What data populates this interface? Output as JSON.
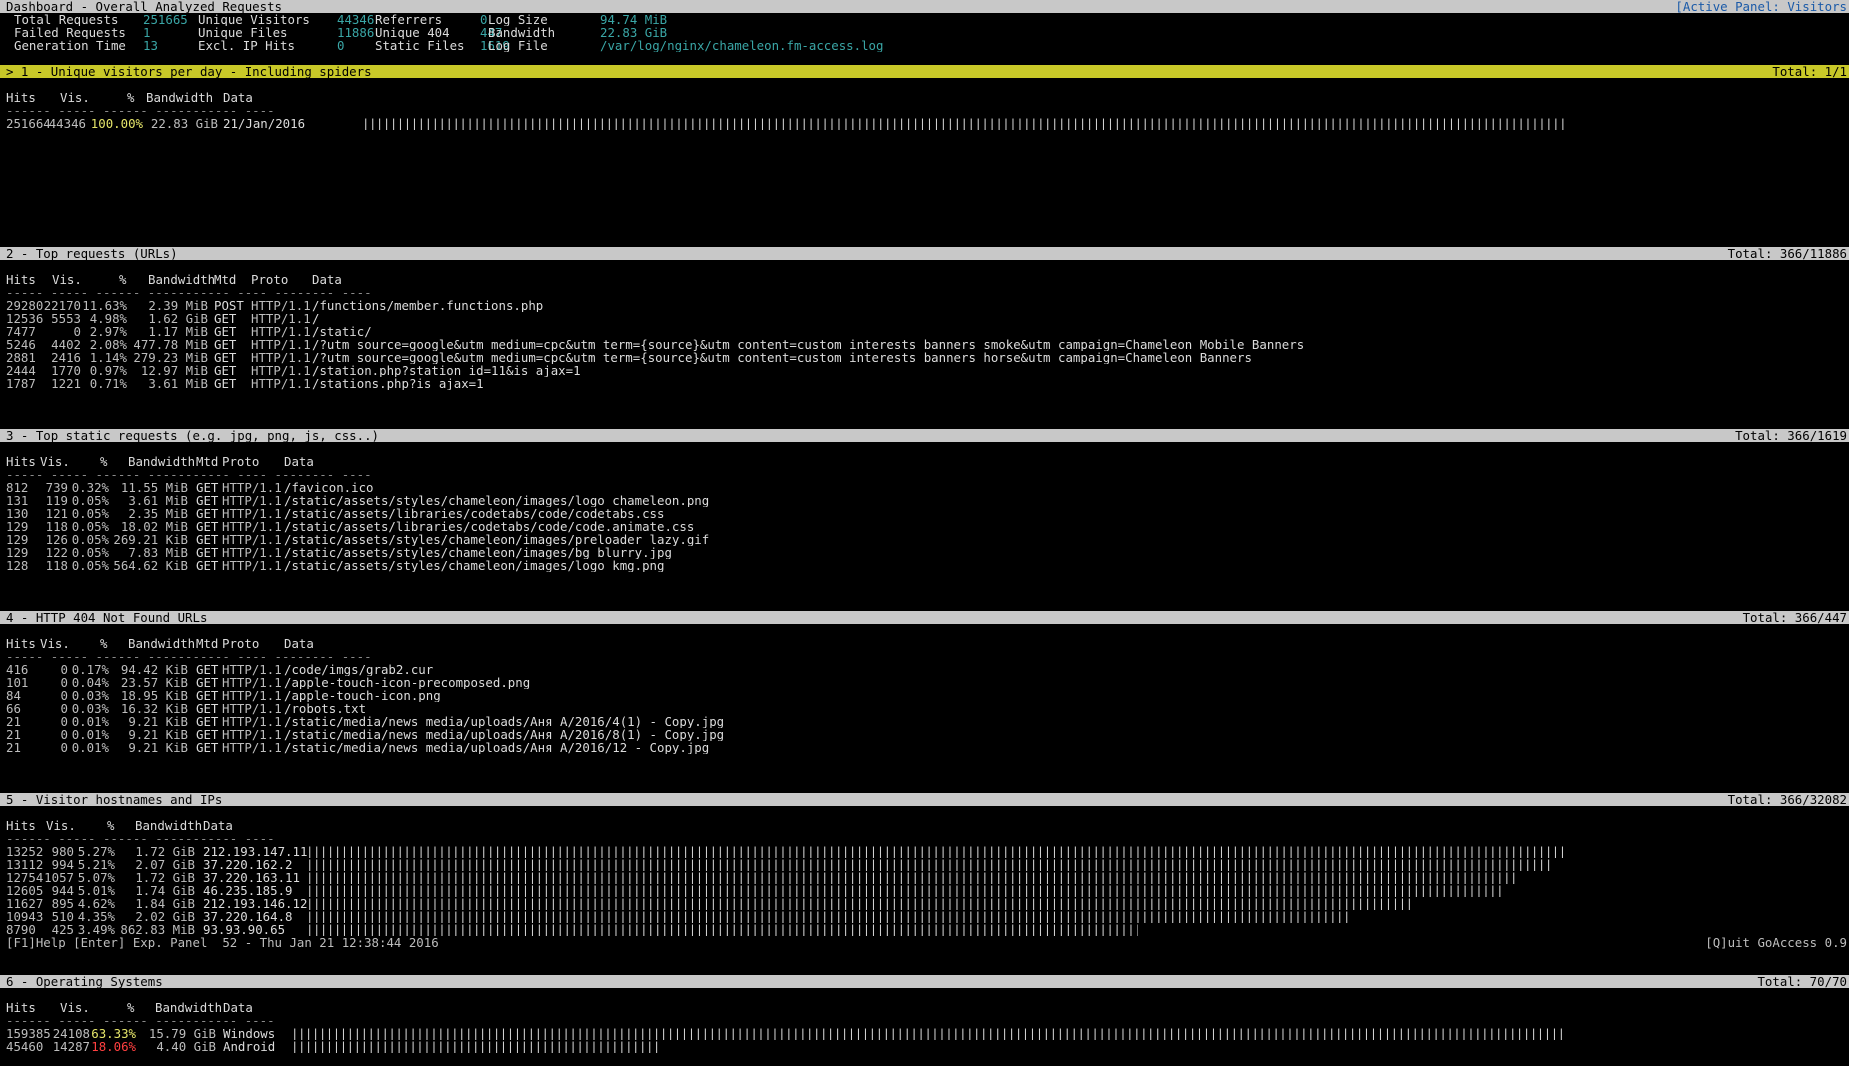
{
  "header": {
    "title": "Dashboard - Overall Analyzed Requests",
    "active_panel": "[Active Panel: Visitors"
  },
  "overall": {
    "rows": [
      [
        {
          "label": "Total Requests",
          "value": "251665"
        },
        {
          "label": "Unique Visitors",
          "value": "44346"
        },
        {
          "label": "Referrers",
          "value": "0"
        },
        {
          "label": "Log Size",
          "value": "94.74 MiB"
        }
      ],
      [
        {
          "label": "Failed Requests",
          "value": "1"
        },
        {
          "label": "Unique Files",
          "value": "11886"
        },
        {
          "label": "Unique 404",
          "value": "447"
        },
        {
          "label": "Bandwidth",
          "value": "22.83 GiB"
        }
      ],
      [
        {
          "label": "Generation Time",
          "value": "13"
        },
        {
          "label": "Excl. IP Hits",
          "value": "0"
        },
        {
          "label": "Static Files",
          "value": "1619"
        },
        {
          "label": "Log File",
          "value": "/var/log/nginx/chameleon.fm-access.log"
        }
      ]
    ]
  },
  "panels": [
    {
      "title": "> 1 - Unique visitors per day - Including spiders",
      "total": "Total: 1/1",
      "headers": [
        "Hits",
        "Vis.",
        "%",
        "Bandwidth",
        "Data"
      ],
      "rows": [
        {
          "hits": "251664",
          "vis": "44346",
          "pct": "100.00%",
          "bw": "22.83 GiB",
          "data": "21/Jan/2016",
          "bar": 1.0
        }
      ]
    },
    {
      "title": "2 - Top requests (URLs)",
      "total": "Total: 366/11886",
      "headers": [
        "Hits",
        "Vis.",
        "%",
        "Bandwidth",
        "Mtd",
        "Proto",
        "Data"
      ],
      "rows": [
        {
          "hits": "29280",
          "vis": "22170",
          "pct": "11.63%",
          "bw": "2.39 MiB",
          "mtd": "POST",
          "proto": "HTTP/1.1",
          "data": "/functions/member.functions.php"
        },
        {
          "hits": "12536",
          "vis": "5553",
          "pct": "4.98%",
          "bw": "1.62 GiB",
          "mtd": "GET",
          "proto": "HTTP/1.1",
          "data": "/"
        },
        {
          "hits": "7477",
          "vis": "0",
          "pct": "2.97%",
          "bw": "1.17 MiB",
          "mtd": "GET",
          "proto": "HTTP/1.1",
          "data": "/static/"
        },
        {
          "hits": "5246",
          "vis": "4402",
          "pct": "2.08%",
          "bw": "477.78 MiB",
          "mtd": "GET",
          "proto": "HTTP/1.1",
          "data": "/?utm_source=google&utm_medium=cpc&utm_term={source}&utm_content=custom_interests_banners_smoke&utm_campaign=Chameleon_Mobile_Banners"
        },
        {
          "hits": "2881",
          "vis": "2416",
          "pct": "1.14%",
          "bw": "279.23 MiB",
          "mtd": "GET",
          "proto": "HTTP/1.1",
          "data": "/?utm_source=google&utm_medium=cpc&utm_term={source}&utm_content=custom_interests_banners_horse&utm_campaign=Chameleon_Banners"
        },
        {
          "hits": "2444",
          "vis": "1770",
          "pct": "0.97%",
          "bw": "12.97 MiB",
          "mtd": "GET",
          "proto": "HTTP/1.1",
          "data": "/station.php?station_id=11&is_ajax=1"
        },
        {
          "hits": "1787",
          "vis": "1221",
          "pct": "0.71%",
          "bw": "3.61 MiB",
          "mtd": "GET",
          "proto": "HTTP/1.1",
          "data": "/stations.php?is_ajax=1"
        }
      ]
    },
    {
      "title": "3 - Top static requests (e.g. jpg, png, js, css..)",
      "total": "Total: 366/1619",
      "headers": [
        "Hits",
        "Vis.",
        "%",
        "Bandwidth",
        "Mtd",
        "Proto",
        "Data"
      ],
      "rows": [
        {
          "hits": "812",
          "vis": "739",
          "pct": "0.32%",
          "bw": "11.55 MiB",
          "mtd": "GET",
          "proto": "HTTP/1.1",
          "data": "/favicon.ico"
        },
        {
          "hits": "131",
          "vis": "119",
          "pct": "0.05%",
          "bw": "3.61 MiB",
          "mtd": "GET",
          "proto": "HTTP/1.1",
          "data": "/static/assets/styles/chameleon/images/logo_chameleon.png"
        },
        {
          "hits": "130",
          "vis": "121",
          "pct": "0.05%",
          "bw": "2.35 MiB",
          "mtd": "GET",
          "proto": "HTTP/1.1",
          "data": "/static/assets/libraries/codetabs/code/codetabs.css"
        },
        {
          "hits": "129",
          "vis": "118",
          "pct": "0.05%",
          "bw": "18.02 MiB",
          "mtd": "GET",
          "proto": "HTTP/1.1",
          "data": "/static/assets/libraries/codetabs/code/code.animate.css"
        },
        {
          "hits": "129",
          "vis": "126",
          "pct": "0.05%",
          "bw": "269.21 KiB",
          "mtd": "GET",
          "proto": "HTTP/1.1",
          "data": "/static/assets/styles/chameleon/images/preloader_lazy.gif"
        },
        {
          "hits": "129",
          "vis": "122",
          "pct": "0.05%",
          "bw": "7.83 MiB",
          "mtd": "GET",
          "proto": "HTTP/1.1",
          "data": "/static/assets/styles/chameleon/images/bg_blurry.jpg"
        },
        {
          "hits": "128",
          "vis": "118",
          "pct": "0.05%",
          "bw": "564.62 KiB",
          "mtd": "GET",
          "proto": "HTTP/1.1",
          "data": "/static/assets/styles/chameleon/images/logo_kmg.png"
        }
      ]
    },
    {
      "title": "4 - HTTP 404 Not Found URLs",
      "total": "Total: 366/447",
      "headers": [
        "Hits",
        "Vis.",
        "%",
        "Bandwidth",
        "Mtd",
        "Proto",
        "Data"
      ],
      "rows": [
        {
          "hits": "416",
          "vis": "0",
          "pct": "0.17%",
          "bw": "94.42 KiB",
          "mtd": "GET",
          "proto": "HTTP/1.1",
          "data": "/code/imgs/grab2.cur"
        },
        {
          "hits": "101",
          "vis": "0",
          "pct": "0.04%",
          "bw": "23.57 KiB",
          "mtd": "GET",
          "proto": "HTTP/1.1",
          "data": "/apple-touch-icon-precomposed.png"
        },
        {
          "hits": "84",
          "vis": "0",
          "pct": "0.03%",
          "bw": "18.95 KiB",
          "mtd": "GET",
          "proto": "HTTP/1.1",
          "data": "/apple-touch-icon.png"
        },
        {
          "hits": "66",
          "vis": "0",
          "pct": "0.03%",
          "bw": "16.32 KiB",
          "mtd": "GET",
          "proto": "HTTP/1.1",
          "data": "/robots.txt"
        },
        {
          "hits": "21",
          "vis": "0",
          "pct": "0.01%",
          "bw": "9.21 KiB",
          "mtd": "GET",
          "proto": "HTTP/1.1",
          "data": "/static/media/news_media/uploads/Аня А/2016/4(1) - Copy.jpg"
        },
        {
          "hits": "21",
          "vis": "0",
          "pct": "0.01%",
          "bw": "9.21 KiB",
          "mtd": "GET",
          "proto": "HTTP/1.1",
          "data": "/static/media/news_media/uploads/Аня А/2016/8(1) - Copy.jpg"
        },
        {
          "hits": "21",
          "vis": "0",
          "pct": "0.01%",
          "bw": "9.21 KiB",
          "mtd": "GET",
          "proto": "HTTP/1.1",
          "data": "/static/media/news_media/uploads/Аня А/2016/12 - Copy.jpg"
        }
      ]
    },
    {
      "title": "5 - Visitor hostnames and IPs",
      "total": "Total: 366/32082",
      "headers": [
        "Hits",
        "Vis.",
        "%",
        "Bandwidth",
        "Data"
      ],
      "rows": [
        {
          "hits": "13252",
          "vis": "980",
          "pct": "5.27%",
          "bw": "1.72 GiB",
          "data": "212.193.147.11",
          "bar": 1.0
        },
        {
          "hits": "13112",
          "vis": "994",
          "pct": "5.21%",
          "bw": "2.07 GiB",
          "data": "37.220.162.2",
          "bar": 0.99
        },
        {
          "hits": "12754",
          "vis": "1057",
          "pct": "5.07%",
          "bw": "1.72 GiB",
          "data": "37.220.163.11",
          "bar": 0.96
        },
        {
          "hits": "12605",
          "vis": "944",
          "pct": "5.01%",
          "bw": "1.74 GiB",
          "data": "46.235.185.9",
          "bar": 0.95
        },
        {
          "hits": "11627",
          "vis": "895",
          "pct": "4.62%",
          "bw": "1.84 GiB",
          "data": "212.193.146.12",
          "bar": 0.88
        },
        {
          "hits": "10943",
          "vis": "510",
          "pct": "4.35%",
          "bw": "2.02 GiB",
          "data": "37.220.164.8",
          "bar": 0.83
        },
        {
          "hits": "8790",
          "vis": "425",
          "pct": "3.49%",
          "bw": "862.83 MiB",
          "data": "93.93.90.65",
          "bar": 0.66
        }
      ]
    },
    {
      "title": "6 - Operating Systems",
      "total": "Total: 70/70",
      "headers": [
        "Hits",
        "Vis.",
        "%",
        "Bandwidth",
        "Data"
      ],
      "rows": [
        {
          "hits": "159385",
          "vis": "24108",
          "pct": "63.33%",
          "bw": "15.79 GiB",
          "data": "Windows",
          "bar": 1.0
        },
        {
          "hits": "45460",
          "vis": "14287",
          "pct": "18.06%",
          "bw": "4.40 GiB",
          "data": "Android",
          "bar": 0.29
        }
      ]
    }
  ],
  "footer": {
    "left": "[F1]Help [Enter] Exp. Panel  52 - Thu Jan 21 12:38:44 2016",
    "right": "[Q]uit GoAccess 0.9"
  },
  "colors": {
    "header_bar": "#c8c8c8",
    "active_bar": "#c8c828",
    "value_teal": "#3aa6a6",
    "pct_yellow": "#e6e66a",
    "pct_red": "#ff4040"
  }
}
